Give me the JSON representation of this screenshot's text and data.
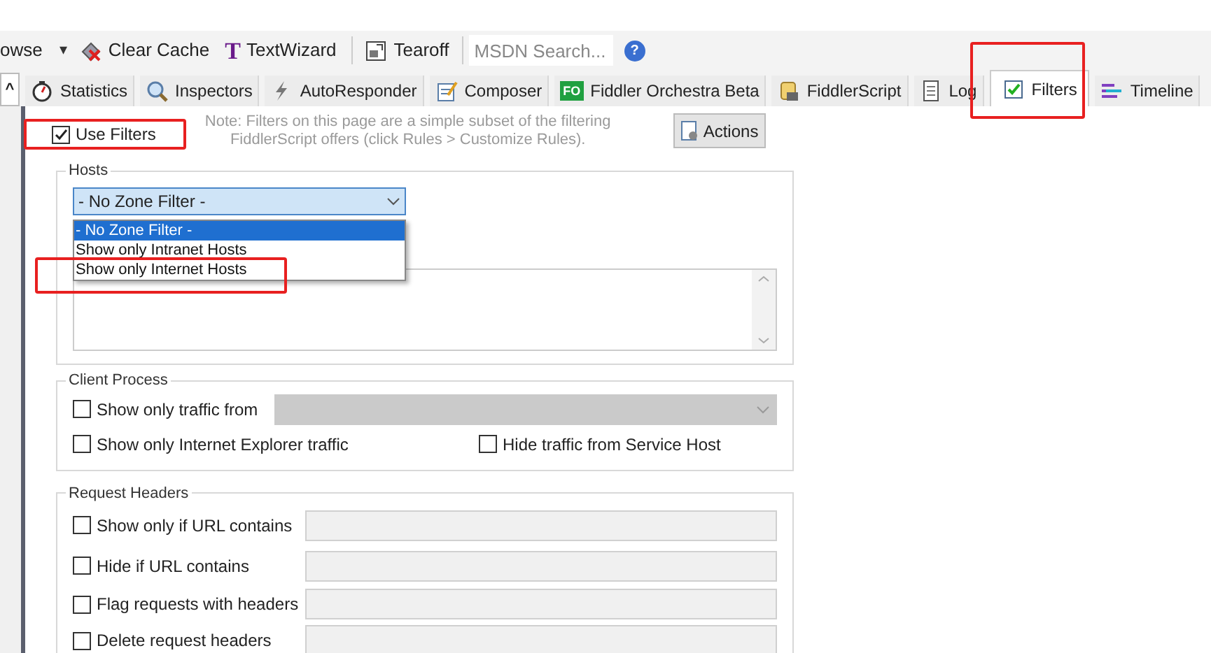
{
  "toolbar": {
    "cut_label": "owse",
    "caret": "▾",
    "buttons": [
      {
        "label": "Clear Cache"
      },
      {
        "label": "TextWizard",
        "icon_text": "T"
      },
      {
        "label": "Tearoff"
      }
    ],
    "search": {
      "placeholder": "MSDN Search..."
    },
    "help": "?"
  },
  "tabs": [
    {
      "label": "Statistics",
      "selected": false
    },
    {
      "label": "Inspectors",
      "selected": false
    },
    {
      "label": "AutoResponder",
      "selected": false
    },
    {
      "label": "Composer",
      "selected": false
    },
    {
      "label": "Fiddler Orchestra Beta",
      "selected": false,
      "icon_text": "FO"
    },
    {
      "label": "FiddlerScript",
      "selected": false
    },
    {
      "label": "Log",
      "selected": false
    },
    {
      "label": "Filters",
      "selected": true
    },
    {
      "label": "Timeline",
      "selected": false
    }
  ],
  "collapse_button": "^",
  "filters": {
    "use_filters": {
      "label": "Use Filters",
      "checked": true
    },
    "note": "Note: Filters on this page are a simple subset of the filtering FiddlerScript offers (click Rules > Customize Rules).",
    "actions_button": "Actions",
    "hosts": {
      "title": "Hosts",
      "zone_select": {
        "value": "- No Zone Filter -",
        "expanded": true,
        "options": [
          {
            "label": "- No Zone Filter -",
            "selected": true
          },
          {
            "label": "Show only Intranet Hosts",
            "selected": false
          },
          {
            "label": "Show only Internet Hosts",
            "selected": false
          }
        ]
      }
    },
    "client_process": {
      "title": "Client Process",
      "traffic_from": {
        "label": "Show only traffic from",
        "checked": false
      },
      "options": [
        {
          "label": "Show only Internet Explorer traffic",
          "checked": false
        },
        {
          "label": "Hide traffic from Service Host",
          "checked": false
        }
      ]
    },
    "request_headers": {
      "title": "Request Headers",
      "rows": [
        {
          "label": "Show only if URL contains",
          "checked": false
        },
        {
          "label": "Hide if URL contains",
          "checked": false
        },
        {
          "label": "Flag requests with headers",
          "checked": false
        },
        {
          "label": "Delete request headers",
          "checked": false
        }
      ]
    }
  }
}
